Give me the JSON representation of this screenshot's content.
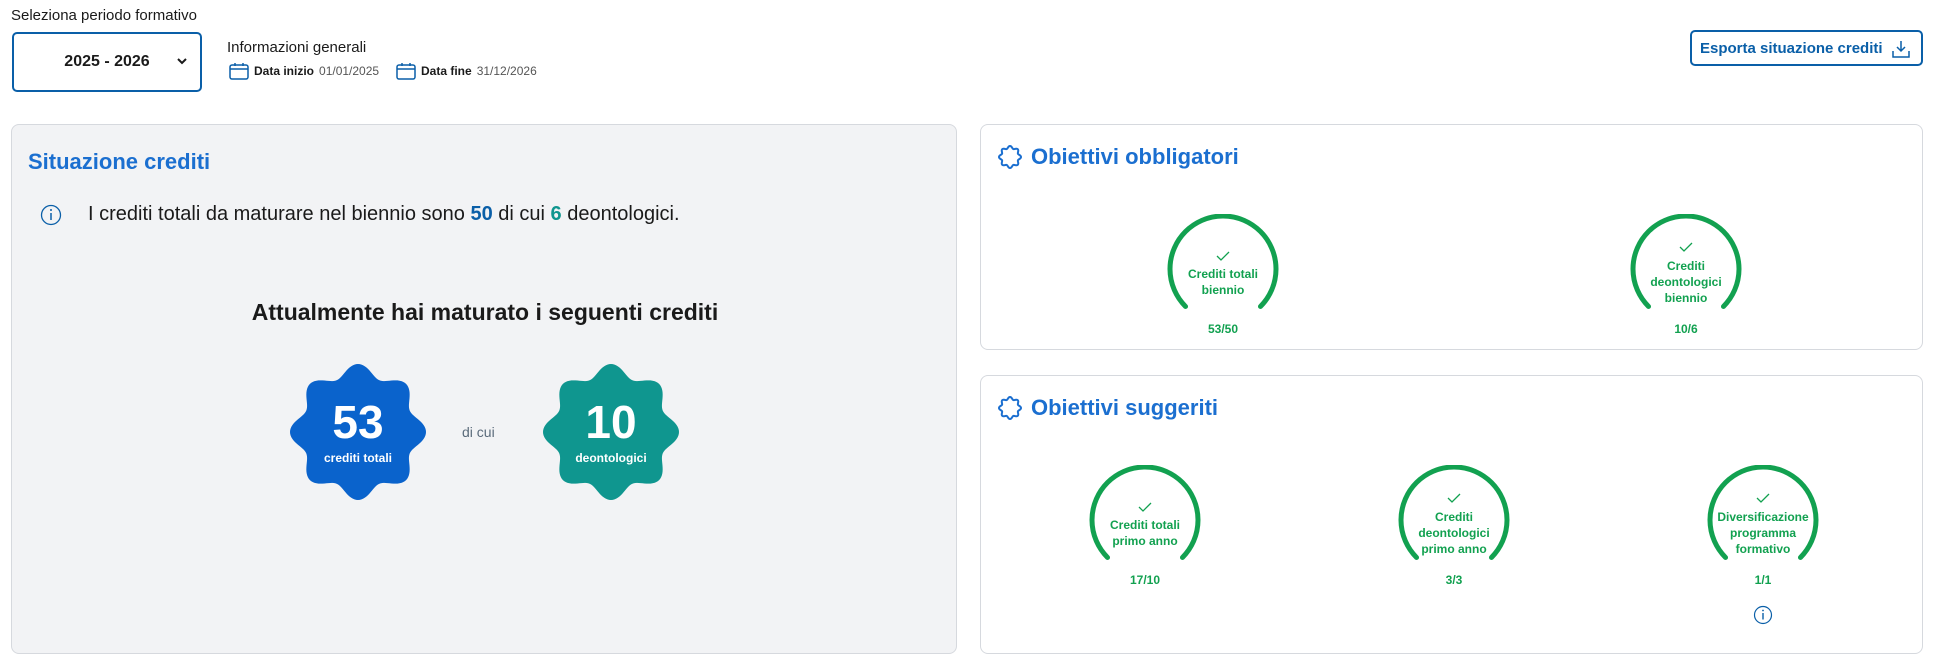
{
  "header": {
    "period_label": "Seleziona periodo formativo",
    "period_value": "2025 - 2026",
    "info_title": "Informazioni generali",
    "start_label": "Data inizio",
    "start_value": "01/01/2025",
    "end_label": "Data fine",
    "end_value": "31/12/2026",
    "export_label": "Esporta situazione crediti"
  },
  "situazione": {
    "title": "Situazione crediti",
    "info_prefix": "I crediti totali da maturare nel biennio sono",
    "total_required": "50",
    "info_middle": "di cui",
    "deont_required": "6",
    "info_suffix": "deontologici.",
    "maturato_title": "Attualmente hai maturato i seguenti crediti",
    "total_value": "53",
    "total_label": "crediti totali",
    "dicui": "di cui",
    "deont_value": "10",
    "deont_label": "deontologici"
  },
  "obbligatori": {
    "title": "Obiettivi obbligatori",
    "items": [
      {
        "label_1": "Crediti totali",
        "label_2": "biennio",
        "label_3": "",
        "value": "53/50"
      },
      {
        "label_1": "Crediti",
        "label_2": "deontologici",
        "label_3": "biennio",
        "value": "10/6"
      }
    ]
  },
  "suggeriti": {
    "title": "Obiettivi suggeriti",
    "items": [
      {
        "label_1": "Crediti totali",
        "label_2": "primo anno",
        "label_3": "",
        "value": "17/10"
      },
      {
        "label_1": "Crediti",
        "label_2": "deontologici",
        "label_3": "primo anno",
        "value": "3/3"
      },
      {
        "label_1": "Diversificazione",
        "label_2": "programma",
        "label_3": "formativo",
        "value": "1/1"
      }
    ]
  },
  "colors": {
    "accent": "#0a5fa8",
    "title_blue": "#1b6fd0",
    "teal": "#0f968f",
    "success_green": "#12a150"
  },
  "icons": [
    "chevron-down-icon",
    "calendar-icon",
    "download-icon",
    "info-icon",
    "target-icon",
    "check-icon"
  ]
}
